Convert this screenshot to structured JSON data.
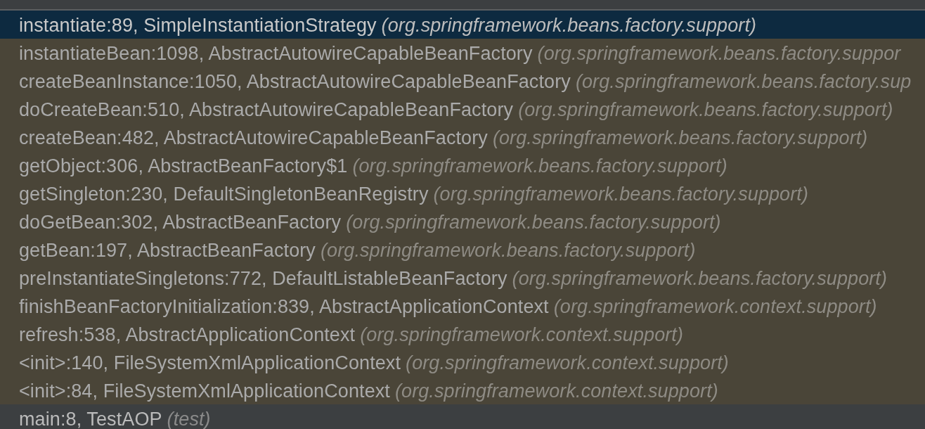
{
  "frames": [
    {
      "method": "instantiate:89, SimpleInstantiationStrategy",
      "package": "(org.springframework.beans.factory.support)",
      "kind": "library",
      "selected": true
    },
    {
      "method": "instantiateBean:1098, AbstractAutowireCapableBeanFactory",
      "package": "(org.springframework.beans.factory.suppor",
      "kind": "library",
      "selected": false
    },
    {
      "method": "createBeanInstance:1050, AbstractAutowireCapableBeanFactory",
      "package": "(org.springframework.beans.factory.sup",
      "kind": "library",
      "selected": false
    },
    {
      "method": "doCreateBean:510, AbstractAutowireCapableBeanFactory",
      "package": "(org.springframework.beans.factory.support)",
      "kind": "library",
      "selected": false
    },
    {
      "method": "createBean:482, AbstractAutowireCapableBeanFactory",
      "package": "(org.springframework.beans.factory.support)",
      "kind": "library",
      "selected": false
    },
    {
      "method": "getObject:306, AbstractBeanFactory$1",
      "package": "(org.springframework.beans.factory.support)",
      "kind": "library",
      "selected": false
    },
    {
      "method": "getSingleton:230, DefaultSingletonBeanRegistry",
      "package": "(org.springframework.beans.factory.support)",
      "kind": "library",
      "selected": false
    },
    {
      "method": "doGetBean:302, AbstractBeanFactory",
      "package": "(org.springframework.beans.factory.support)",
      "kind": "library",
      "selected": false
    },
    {
      "method": "getBean:197, AbstractBeanFactory",
      "package": "(org.springframework.beans.factory.support)",
      "kind": "library",
      "selected": false
    },
    {
      "method": "preInstantiateSingletons:772, DefaultListableBeanFactory",
      "package": "(org.springframework.beans.factory.support)",
      "kind": "library",
      "selected": false
    },
    {
      "method": "finishBeanFactoryInitialization:839, AbstractApplicationContext",
      "package": "(org.springframework.context.support)",
      "kind": "library",
      "selected": false
    },
    {
      "method": "refresh:538, AbstractApplicationContext",
      "package": "(org.springframework.context.support)",
      "kind": "library",
      "selected": false
    },
    {
      "method": "<init>:140, FileSystemXmlApplicationContext",
      "package": "(org.springframework.context.support)",
      "kind": "library",
      "selected": false
    },
    {
      "method": "<init>:84, FileSystemXmlApplicationContext",
      "package": "(org.springframework.context.support)",
      "kind": "library",
      "selected": false
    },
    {
      "method": "main:8, TestAOP",
      "package": "(test)",
      "kind": "user",
      "selected": false
    }
  ]
}
